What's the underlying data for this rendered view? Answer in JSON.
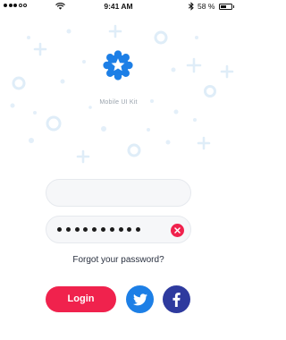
{
  "status_bar": {
    "time": "9:41 AM",
    "battery_text": "58 %",
    "battery_level": 0.58
  },
  "app": {
    "name": "Mobile UI Kit",
    "logo_icon": "star-badge-icon",
    "accent_color": "#1d7fe6"
  },
  "form": {
    "username_value": "",
    "password_length": 10,
    "forgot_label": "Forgot your password?",
    "login_label": "Login"
  },
  "colors": {
    "primary": "#f0224d",
    "twitter": "#1d7fe6",
    "facebook": "#2e3a9e"
  }
}
